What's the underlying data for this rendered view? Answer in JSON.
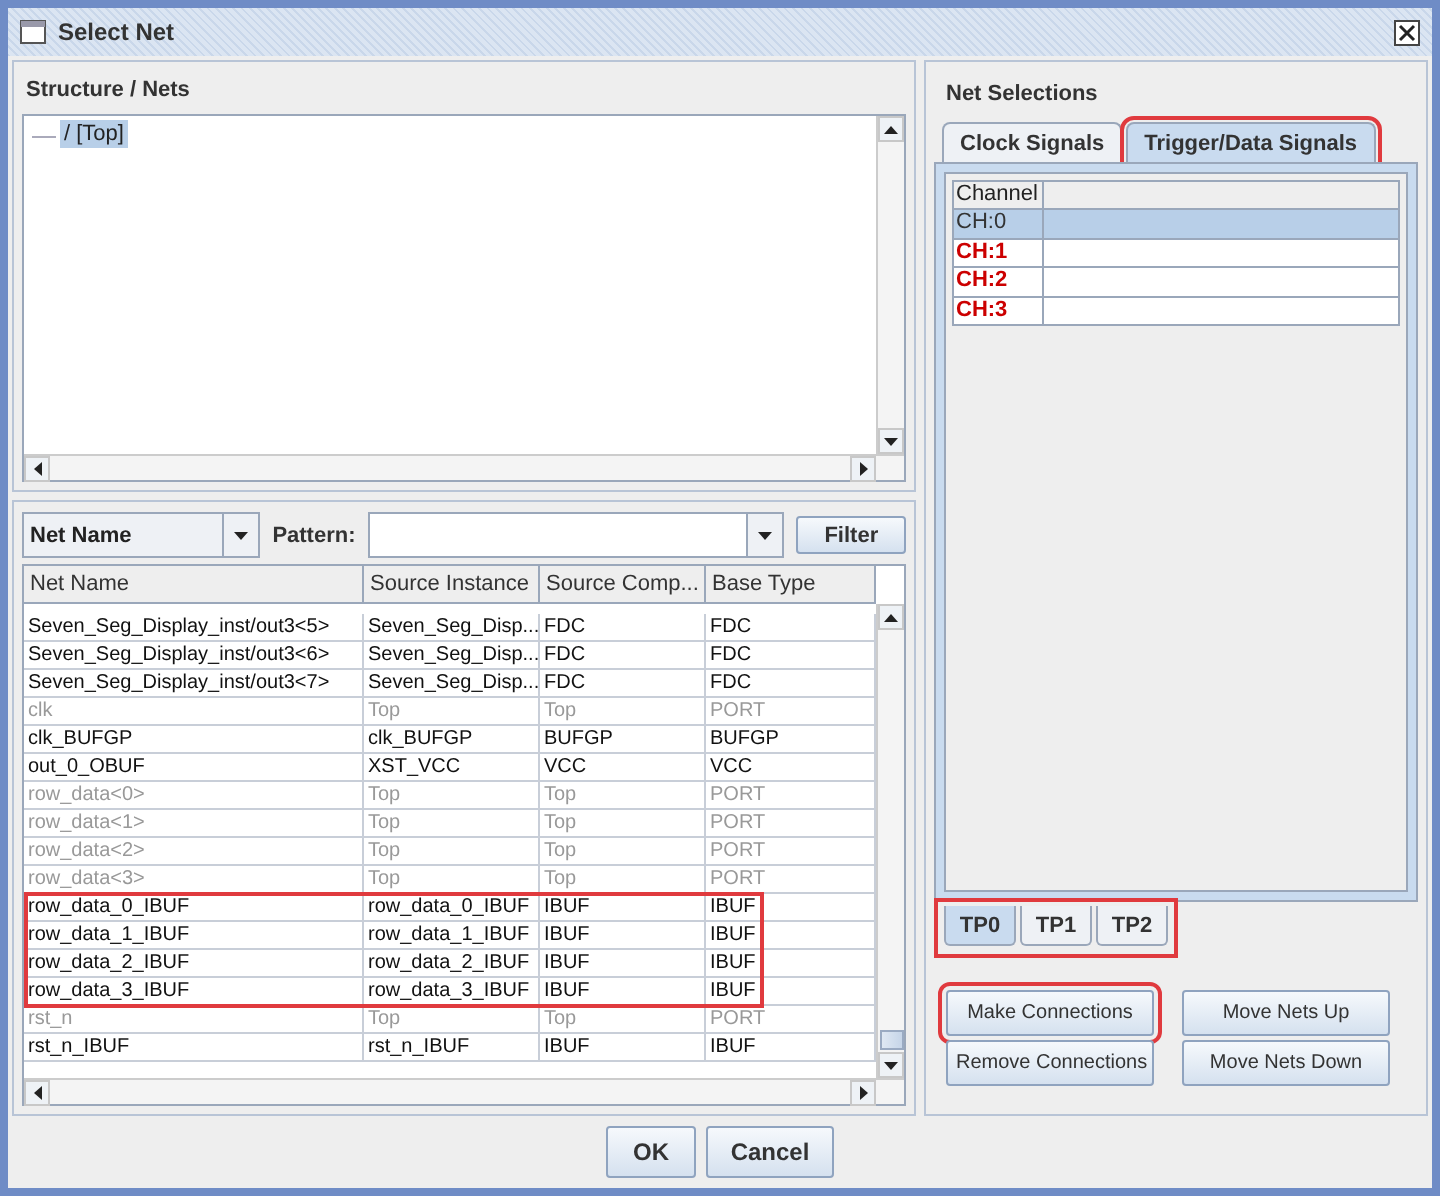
{
  "window": {
    "title": "Select Net"
  },
  "structure": {
    "title": "Structure / Nets",
    "tree": [
      {
        "label": "/ [Top]",
        "selected": true
      }
    ]
  },
  "filter": {
    "field": "Net Name",
    "pattern_label": "Pattern:",
    "button": "Filter"
  },
  "table": {
    "columns": [
      "Net Name",
      "Source Instance",
      "Source Comp...",
      "Base Type"
    ],
    "rows": [
      {
        "cells": [
          "Seven_Seg_Display_inst/out3<5>",
          "Seven_Seg_Disp...",
          "FDC",
          "FDC"
        ],
        "dimmed": false,
        "annotated": false
      },
      {
        "cells": [
          "Seven_Seg_Display_inst/out3<6>",
          "Seven_Seg_Disp...",
          "FDC",
          "FDC"
        ],
        "dimmed": false,
        "annotated": false
      },
      {
        "cells": [
          "Seven_Seg_Display_inst/out3<7>",
          "Seven_Seg_Disp...",
          "FDC",
          "FDC"
        ],
        "dimmed": false,
        "annotated": false
      },
      {
        "cells": [
          "clk",
          "Top",
          "Top",
          "PORT"
        ],
        "dimmed": true,
        "annotated": false
      },
      {
        "cells": [
          "clk_BUFGP",
          "clk_BUFGP",
          "BUFGP",
          "BUFGP"
        ],
        "dimmed": false,
        "annotated": false
      },
      {
        "cells": [
          "out_0_OBUF",
          "XST_VCC",
          "VCC",
          "VCC"
        ],
        "dimmed": false,
        "annotated": false
      },
      {
        "cells": [
          "row_data<0>",
          "Top",
          "Top",
          "PORT"
        ],
        "dimmed": true,
        "annotated": false
      },
      {
        "cells": [
          "row_data<1>",
          "Top",
          "Top",
          "PORT"
        ],
        "dimmed": true,
        "annotated": false
      },
      {
        "cells": [
          "row_data<2>",
          "Top",
          "Top",
          "PORT"
        ],
        "dimmed": true,
        "annotated": false
      },
      {
        "cells": [
          "row_data<3>",
          "Top",
          "Top",
          "PORT"
        ],
        "dimmed": true,
        "annotated": false
      },
      {
        "cells": [
          "row_data_0_IBUF",
          "row_data_0_IBUF",
          "IBUF",
          "IBUF"
        ],
        "dimmed": false,
        "annotated": true
      },
      {
        "cells": [
          "row_data_1_IBUF",
          "row_data_1_IBUF",
          "IBUF",
          "IBUF"
        ],
        "dimmed": false,
        "annotated": true
      },
      {
        "cells": [
          "row_data_2_IBUF",
          "row_data_2_IBUF",
          "IBUF",
          "IBUF"
        ],
        "dimmed": false,
        "annotated": true
      },
      {
        "cells": [
          "row_data_3_IBUF",
          "row_data_3_IBUF",
          "IBUF",
          "IBUF"
        ],
        "dimmed": false,
        "annotated": true
      },
      {
        "cells": [
          "rst_n",
          "Top",
          "Top",
          "PORT"
        ],
        "dimmed": true,
        "annotated": false
      },
      {
        "cells": [
          "rst_n_IBUF",
          "rst_n_IBUF",
          "IBUF",
          "IBUF"
        ],
        "dimmed": false,
        "annotated": false
      }
    ]
  },
  "net_selections": {
    "title": "Net Selections",
    "tabs": [
      {
        "label": "Clock Signals",
        "selected": false,
        "annotated": false
      },
      {
        "label": "Trigger/Data Signals",
        "selected": true,
        "annotated": true
      }
    ],
    "channel_header": "Channel",
    "channels": [
      {
        "name": "CH:0",
        "selected": true,
        "color": "#333333"
      },
      {
        "name": "CH:1",
        "selected": false,
        "color": "#cc0000"
      },
      {
        "name": "CH:2",
        "selected": false,
        "color": "#cc0000"
      },
      {
        "name": "CH:3",
        "selected": false,
        "color": "#cc0000"
      }
    ],
    "trigger_ports": {
      "annotated": true,
      "tabs": [
        {
          "label": "TP0",
          "selected": true
        },
        {
          "label": "TP1",
          "selected": false
        },
        {
          "label": "TP2",
          "selected": false
        }
      ]
    },
    "buttons": [
      {
        "label": "Make Connections",
        "annotated": true
      },
      {
        "label": "Move Nets Up",
        "annotated": false
      },
      {
        "label": "Remove Connections",
        "annotated": false
      },
      {
        "label": "Move Nets Down",
        "annotated": false
      }
    ]
  },
  "footer": {
    "buttons": [
      "OK",
      "Cancel"
    ]
  }
}
